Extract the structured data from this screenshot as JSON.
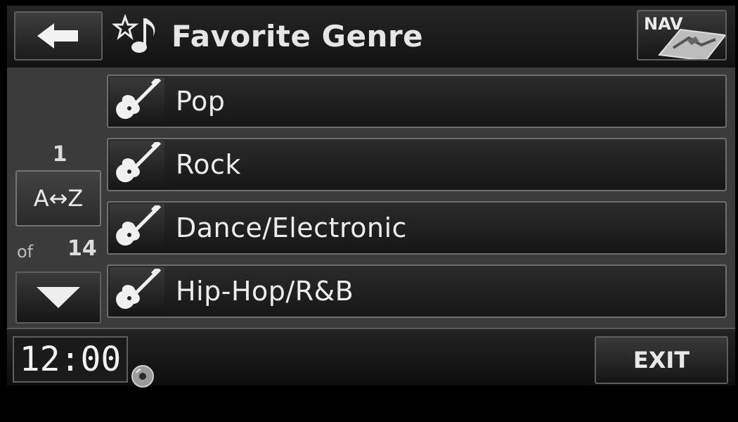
{
  "header": {
    "title": "Favorite Genre",
    "back_icon": "back-arrow-icon",
    "genre_icon": "star-music-note-icon",
    "nav_label": "NAV",
    "nav_icon": "map-icon"
  },
  "pager": {
    "current": "1",
    "sort_label": "A↔Z",
    "of_label": "of",
    "total": "14",
    "down_icon": "chevron-down-icon"
  },
  "genres": [
    {
      "label": "Pop",
      "icon": "guitar-icon"
    },
    {
      "label": "Rock",
      "icon": "guitar-icon"
    },
    {
      "label": "Dance/Electronic",
      "icon": "guitar-icon"
    },
    {
      "label": "Hip-Hop/R&B",
      "icon": "guitar-icon"
    }
  ],
  "footer": {
    "clock": "12:00",
    "disc_icon": "disc-icon",
    "exit_label": "EXIT"
  },
  "colors": {
    "background": "#000000",
    "panel": "#3b3b3b",
    "button": "#2a2a2a",
    "border": "#6e6e6e",
    "text": "#e8e8e8"
  }
}
